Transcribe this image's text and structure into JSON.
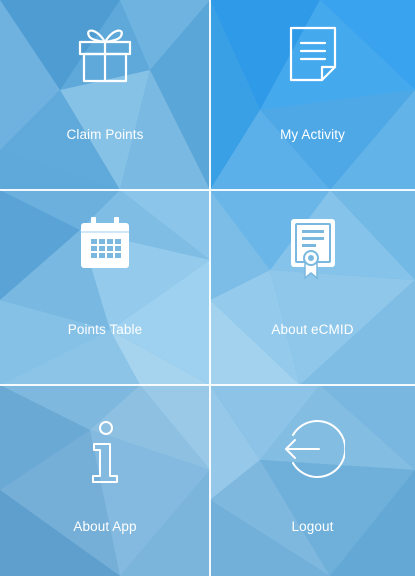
{
  "menu": {
    "tiles": [
      {
        "label": "Claim Points",
        "icon": "gift-icon"
      },
      {
        "label": "My Activity",
        "icon": "document-icon"
      },
      {
        "label": "Points Table",
        "icon": "calendar-icon"
      },
      {
        "label": "About eCMID",
        "icon": "certificate-icon"
      },
      {
        "label": "About App",
        "icon": "info-icon"
      },
      {
        "label": "Logout",
        "icon": "logout-icon"
      }
    ]
  },
  "colors": {
    "background": "#5aa6d8",
    "accent": "#3aa0e6",
    "text": "#ffffff"
  }
}
